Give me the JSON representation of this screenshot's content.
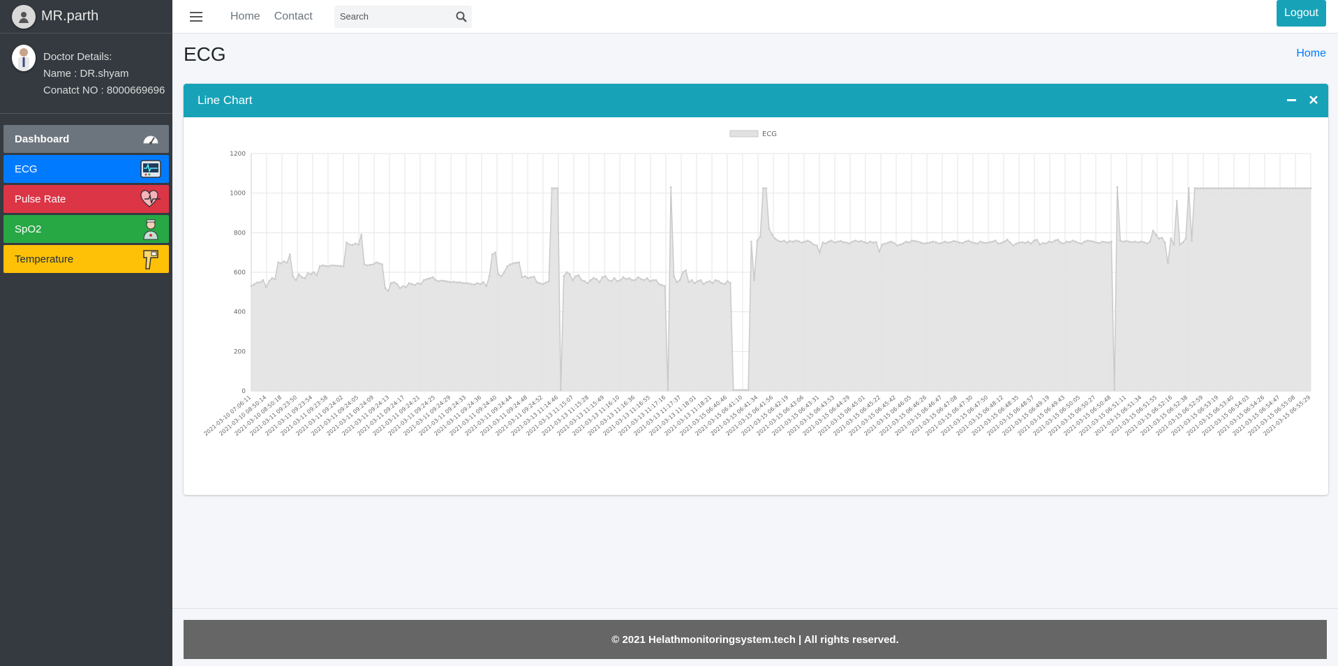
{
  "brand": {
    "name": "MR.parth"
  },
  "doctor": {
    "heading": "Doctor Details:",
    "name_line": "Name : DR.shyam",
    "contact_line": "Conatct NO : 8000669696"
  },
  "sidebar": {
    "items": [
      {
        "label": "Dashboard",
        "icon": "speedometer-icon"
      },
      {
        "label": "ECG",
        "icon": "ecg-monitor-icon"
      },
      {
        "label": "Pulse Rate",
        "icon": "heart-pulse-icon"
      },
      {
        "label": "SpO2",
        "icon": "nurse-icon"
      },
      {
        "label": "Temperature",
        "icon": "thermometer-gun-icon"
      }
    ]
  },
  "header": {
    "links": [
      "Home",
      "Contact"
    ],
    "search_placeholder": "Search",
    "logout_label": "Logout"
  },
  "page": {
    "title": "ECG",
    "breadcrumb": "Home"
  },
  "card": {
    "title": "Line Chart",
    "collapse_icon": "minus-icon",
    "close_icon": "close-icon"
  },
  "footer": {
    "text": "© 2021 Helathmonitoringsystem.tech | All rights reserved."
  },
  "colors": {
    "sidebar_bg": "#343a40",
    "accent": "#17a2b8",
    "dashboard": "#6c757d",
    "ecg": "#007bff",
    "pulse": "#dc3545",
    "spo2": "#28a745",
    "temperature": "#ffc107",
    "chart_fill": "#e2e2e2",
    "chart_line": "#c9c9c9"
  },
  "chart_data": {
    "type": "area",
    "legend": [
      "ECG"
    ],
    "legend_position": "top-center",
    "grid": true,
    "ylim": [
      0,
      1200
    ],
    "yticks": [
      0,
      200,
      400,
      600,
      800,
      1000,
      1200
    ],
    "xtick_labels": [
      "2021-03-10 07:06:11",
      "2021-03-10 08:50:14",
      "2021-03-10 08:50:18",
      "2021-03-11 09:23:50",
      "2021-03-11 09:23:54",
      "2021-03-11 09:23:58",
      "2021-03-11 09:24:02",
      "2021-03-11 09:24:05",
      "2021-03-11 09:24:09",
      "2021-03-11 09:24:13",
      "2021-03-11 09:24:17",
      "2021-03-11 09:24:21",
      "2021-03-11 09:24:25",
      "2021-03-11 09:24:29",
      "2021-03-11 09:24:33",
      "2021-03-11 09:24:36",
      "2021-03-11 09:24:40",
      "2021-03-11 09:24:44",
      "2021-03-11 09:24:48",
      "2021-03-11 09:24:52",
      "2021-03-13 11:14:46",
      "2021-03-13 11:15:07",
      "2021-03-13 11:15:28",
      "2021-03-13 11:15:49",
      "2021-03-13 11:16:10",
      "2021-03-13 11:16:36",
      "2021-03-13 11:16:55",
      "2021-03-13 11:17:16",
      "2021-03-13 11:17:37",
      "2021-03-13 11:18:01",
      "2021-03-13 11:18:21",
      "2021-03-15 06:40:46",
      "2021-03-15 06:41:10",
      "2021-03-15 06:41:34",
      "2021-03-15 06:41:56",
      "2021-03-15 06:42:19",
      "2021-03-15 06:43:06",
      "2021-03-15 06:43:31",
      "2021-03-15 06:43:53",
      "2021-03-15 06:44:29",
      "2021-03-15 06:45:01",
      "2021-03-15 06:45:22",
      "2021-03-15 06:45:42",
      "2021-03-15 06:46:05",
      "2021-03-15 06:46:26",
      "2021-03-15 06:46:47",
      "2021-03-15 06:47:08",
      "2021-03-15 06:47:30",
      "2021-03-15 06:47:50",
      "2021-03-15 06:48:12",
      "2021-03-15 06:48:35",
      "2021-03-15 06:48:57",
      "2021-03-15 06:49:19",
      "2021-03-15 06:49:43",
      "2021-03-15 06:50:05",
      "2021-03-15 06:50:27",
      "2021-03-15 06:50:48",
      "2021-03-15 06:51:11",
      "2021-03-15 06:51:34",
      "2021-03-15 06:51:55",
      "2021-03-15 06:52:16",
      "2021-03-15 06:52:38",
      "2021-03-15 06:52:59",
      "2021-03-15 06:53:19",
      "2021-03-15 06:53:40",
      "2021-03-15 06:54:03",
      "2021-03-15 06:54:26",
      "2021-03-15 06:54:47",
      "2021-03-15 06:55:08",
      "2021-03-15 06:55:29"
    ],
    "series": [
      {
        "name": "ECG",
        "values": [
          530,
          540,
          548,
          550,
          560,
          525,
          555,
          570,
          565,
          650,
          645,
          655,
          648,
          690,
          580,
          560,
          590,
          575,
          570,
          595,
          590,
          600,
          585,
          630,
          635,
          632,
          630,
          635,
          634,
          633,
          632,
          630,
          750,
          740,
          738,
          745,
          740,
          790,
          640,
          635,
          638,
          640,
          650,
          645,
          640,
          520,
          505,
          545,
          550,
          540,
          520,
          530,
          525,
          545,
          540,
          535,
          545,
          540,
          560,
          565,
          570,
          575,
          560,
          555,
          558,
          556,
          553,
          550,
          552,
          548,
          550,
          546,
          545,
          544,
          540,
          538,
          545,
          540,
          550,
          530,
          580,
          690,
          700,
          590,
          580,
          600,
          630,
          640,
          645,
          648,
          650,
          575,
          580,
          570,
          575,
          578,
          550,
          545,
          540,
          548,
          555,
          1025,
          1025,
          1025,
          5,
          580,
          600,
          590,
          560,
          580,
          585,
          560,
          555,
          545,
          560,
          570,
          565,
          550,
          575,
          580,
          560,
          555,
          570,
          555,
          560,
          575,
          565,
          570,
          560,
          560,
          575,
          565,
          560,
          570,
          555,
          560,
          560,
          540,
          535,
          530,
          5,
          1030,
          580,
          550,
          560,
          600,
          610,
          550,
          560,
          545,
          555,
          560,
          540,
          550,
          555,
          545,
          560,
          555,
          545,
          540,
          555,
          545,
          5,
          5,
          5,
          5,
          5,
          5,
          755,
          560,
          760,
          780,
          1025,
          1025,
          820,
          790,
          770,
          760,
          755,
          760,
          750,
          758,
          755,
          760,
          756,
          750,
          755,
          760,
          752,
          740,
          735,
          700,
          750,
          745,
          755,
          760,
          750,
          755,
          758,
          752,
          750,
          745,
          755,
          760,
          755,
          758,
          752,
          748,
          755,
          750,
          752,
          705,
          740,
          745,
          750,
          755,
          748,
          735,
          740,
          745,
          755,
          750,
          760,
          758,
          755,
          750,
          745,
          748,
          750,
          755,
          752,
          745,
          748,
          755,
          750,
          752,
          758,
          755,
          750,
          748,
          755,
          760,
          752,
          748,
          745,
          755,
          750,
          748,
          752,
          755,
          760,
          745,
          748,
          755,
          765,
          750,
          735,
          745,
          750,
          752,
          748,
          755,
          745,
          760,
          765,
          740,
          748,
          745,
          755,
          752,
          760,
          765,
          750,
          745,
          755,
          752,
          760,
          755,
          748,
          745,
          755,
          760,
          758,
          755,
          750,
          748,
          755,
          752,
          750,
          755,
          5,
          1030,
          760,
          755,
          758,
          755,
          752,
          755,
          750,
          755,
          752,
          745,
          755,
          810,
          790,
          770,
          775,
          750,
          645,
          770,
          740,
          960,
          740,
          750,
          770,
          1025,
          760,
          1025,
          1025,
          1025,
          1025,
          1025,
          1025,
          1025,
          1025,
          1025,
          1025,
          1025,
          1025,
          1025,
          1025,
          1025,
          1025,
          1025,
          1025,
          1025,
          1025,
          1025,
          1025,
          1025,
          1025,
          1025,
          1025,
          1025,
          1025,
          1025,
          1025,
          1025,
          1025,
          1025,
          1025,
          1025,
          1025,
          1025,
          1025,
          1025,
          1025
        ]
      }
    ]
  }
}
